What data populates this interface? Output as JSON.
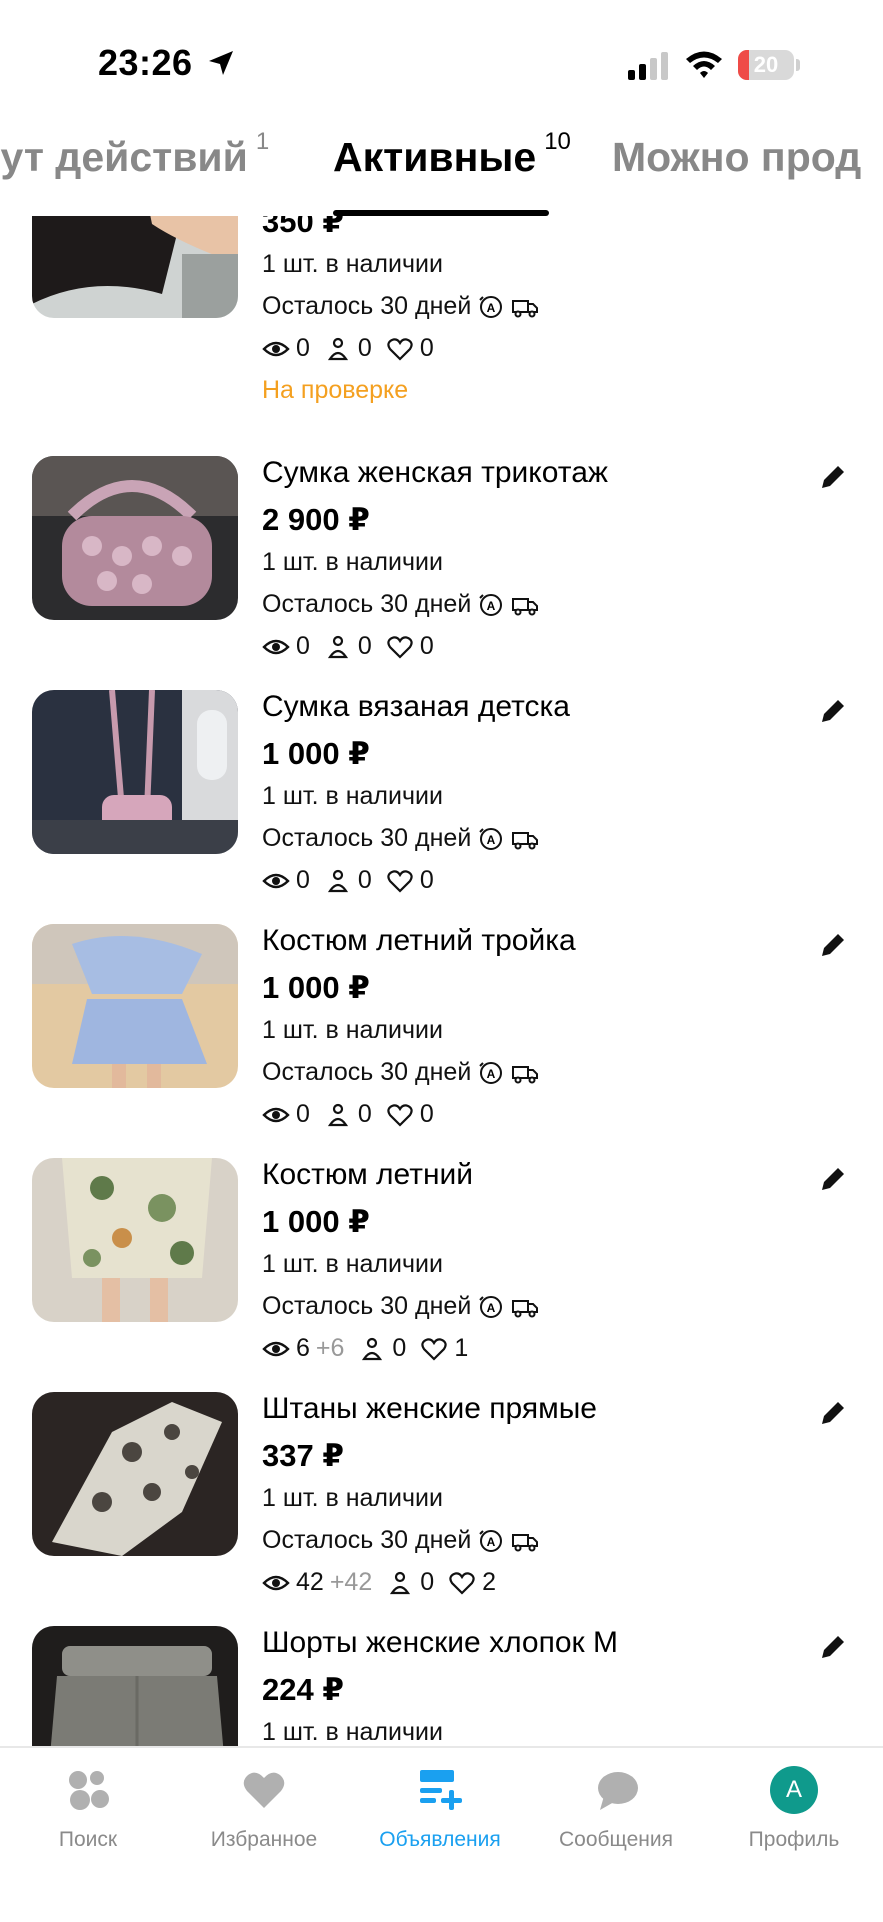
{
  "status_bar": {
    "time": "23:26",
    "battery_text": "20",
    "battery_level": 0.2,
    "battery_color": "#ef4b47"
  },
  "tabs": [
    {
      "label": "Ждут действий",
      "visible_label": "дут действий",
      "count": "1",
      "active": false
    },
    {
      "label": "Активные",
      "count": "10",
      "active": true
    },
    {
      "label": "Можно прод",
      "count": "",
      "active": false
    }
  ],
  "listings": [
    {
      "title": "",
      "price": "350 ₽",
      "stock": "1 шт. в наличии",
      "days_left": "Осталось 30 дней",
      "views": "0",
      "views_delta": "",
      "contacts": "0",
      "favorites": "0",
      "status": "На проверке",
      "thumb_icon": "photo-black-top"
    },
    {
      "title": "Сумка женская трикотаж",
      "price": "2 900 ₽",
      "stock": "1 шт. в наличии",
      "days_left": "Осталось 30 дней",
      "views": "0",
      "views_delta": "",
      "contacts": "0",
      "favorites": "0",
      "status": "",
      "thumb_icon": "photo-knit-bag-pink"
    },
    {
      "title": "Сумка вязаная детска",
      "price": "1 000 ₽",
      "stock": "1 шт. в наличии",
      "days_left": "Осталось 30 дней",
      "views": "0",
      "views_delta": "",
      "contacts": "0",
      "favorites": "0",
      "status": "",
      "thumb_icon": "photo-kids-bag"
    },
    {
      "title": "Костюм летний тройка",
      "price": "1 000 ₽",
      "stock": "1 шт. в наличии",
      "days_left": "Осталось 30 дней",
      "views": "0",
      "views_delta": "",
      "contacts": "0",
      "favorites": "0",
      "status": "",
      "thumb_icon": "photo-blue-suit"
    },
    {
      "title": "Костюм летний",
      "price": "1 000 ₽",
      "stock": "1 шт. в наличии",
      "days_left": "Осталось 30 дней",
      "views": "6",
      "views_delta": "+6",
      "contacts": "0",
      "favorites": "1",
      "status": "",
      "thumb_icon": "photo-print-suit"
    },
    {
      "title": "Штаны женские прямые",
      "price": "337 ₽",
      "stock": "1 шт. в наличии",
      "days_left": "Осталось 30 дней",
      "views": "42",
      "views_delta": "+42",
      "contacts": "0",
      "favorites": "2",
      "status": "",
      "thumb_icon": "photo-paisley-pants"
    },
    {
      "title": "Шорты женские хлопок М",
      "price": "224 ₽",
      "stock": "1 шт. в наличии",
      "days_left": "",
      "views": "",
      "views_delta": "",
      "contacts": "",
      "favorites": "",
      "status": "",
      "thumb_icon": "photo-grey-shorts"
    }
  ],
  "bottom_nav": [
    {
      "label": "Поиск",
      "icon": "search-dots-icon",
      "active": false
    },
    {
      "label": "Избранное",
      "icon": "heart-icon",
      "active": false
    },
    {
      "label": "Объявления",
      "icon": "listings-add-icon",
      "active": true
    },
    {
      "label": "Сообщения",
      "icon": "chat-bubble-icon",
      "active": false
    },
    {
      "label": "Профиль",
      "icon": "avatar",
      "avatar_letter": "A",
      "active": false
    }
  ],
  "colors": {
    "accent": "#1aa0f0",
    "review_status": "#f4a020",
    "avatar": "#0f9a8c"
  }
}
